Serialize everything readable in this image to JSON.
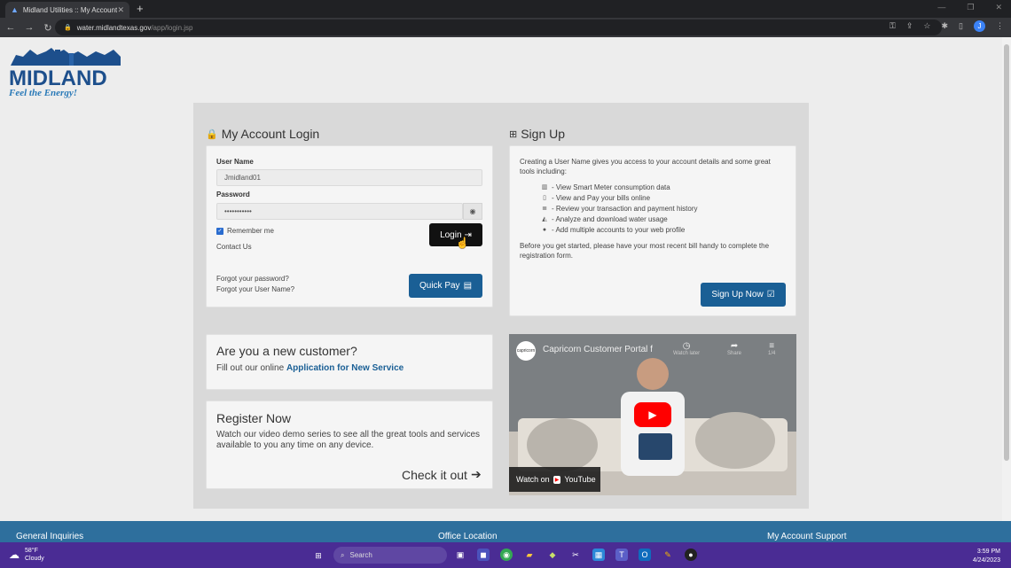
{
  "browser": {
    "tab_title": "Midland Utilities :: My Account L",
    "url_domain": "water.midlandtexas.gov",
    "url_path": "/app/login.jsp",
    "profile_initial": "J"
  },
  "logo": {
    "name": "MIDLAND",
    "tagline": "Feel the Energy!"
  },
  "login": {
    "title": "My Account Login",
    "username_label": "User Name",
    "username_value": "Jmidland01",
    "password_label": "Password",
    "password_value": "•••••••••••",
    "remember_label": "Remember me",
    "contact_label": "Contact Us",
    "login_button": "Login",
    "forgot_password": "Forgot your password?",
    "forgot_username": "Forgot your User Name?",
    "quick_pay": "Quick Pay"
  },
  "signup": {
    "title": "Sign Up",
    "intro": "Creating a User Name gives you access to your account details and some great tools including:",
    "features": [
      {
        "icon": "bar-chart-icon",
        "text": "- View Smart Meter consumption data"
      },
      {
        "icon": "file-icon",
        "text": "- View and Pay your bills online"
      },
      {
        "icon": "list-icon",
        "text": "- Review your transaction and payment history"
      },
      {
        "icon": "area-chart-icon",
        "text": "- Analyze and download water usage"
      },
      {
        "icon": "user-icon",
        "text": "- Add multiple accounts to your web profile"
      }
    ],
    "note": "Before you get started, please have your most recent bill handy to complete the registration form.",
    "button": "Sign Up Now"
  },
  "new_customer": {
    "heading": "Are you a new customer?",
    "text_prefix": "Fill out our online",
    "link": "Application for New Service"
  },
  "register": {
    "heading": "Register Now",
    "text": "Watch our video demo series to see all the great tools and services available to you any time on any device.",
    "link": "Check it out"
  },
  "video": {
    "title": "Capricorn Customer Portal f",
    "channel": "capricorn",
    "watch_later": "Watch later",
    "share": "Share",
    "playlist_count": "1/4",
    "watch_on": "Watch on",
    "platform": "YouTube"
  },
  "footer": {
    "links": [
      "General Inquiries",
      "Office Location",
      "My Account Support"
    ]
  },
  "taskbar": {
    "temperature": "58°F",
    "condition": "Cloudy",
    "search_placeholder": "Search",
    "time": "3:59 PM",
    "date": "4/24/2023"
  },
  "colors": {
    "accent_blue": "#1a5f95",
    "footer_blue": "#2e6f9d",
    "taskbar_purple": "#4a2c94"
  }
}
